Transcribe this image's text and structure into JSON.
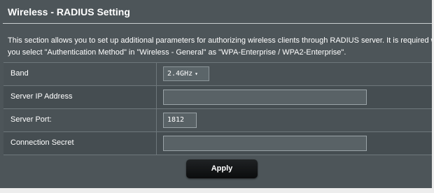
{
  "page": {
    "title": "Wireless - RADIUS Setting",
    "description_line1": "This section allows you to set up additional parameters for authorizing wireless clients through RADIUS server. It is required whil",
    "description_line2": "you select \"Authentication Method\" in \"Wireless - General\" as \"WPA-Enterprise / WPA2-Enterprise\"."
  },
  "form": {
    "band": {
      "label": "Band",
      "value": "2.4GHz",
      "arrow": "▾"
    },
    "server_ip": {
      "label": "Server IP Address",
      "value": ""
    },
    "server_port": {
      "label": "Server Port:",
      "value": "1812"
    },
    "connection_secret": {
      "label": "Connection Secret",
      "value": ""
    }
  },
  "actions": {
    "apply_label": "Apply"
  },
  "colors": {
    "panel_bg": "#4d5559",
    "page_bg": "#ededed",
    "text": "#ffffff",
    "button_bg": "#111314"
  }
}
